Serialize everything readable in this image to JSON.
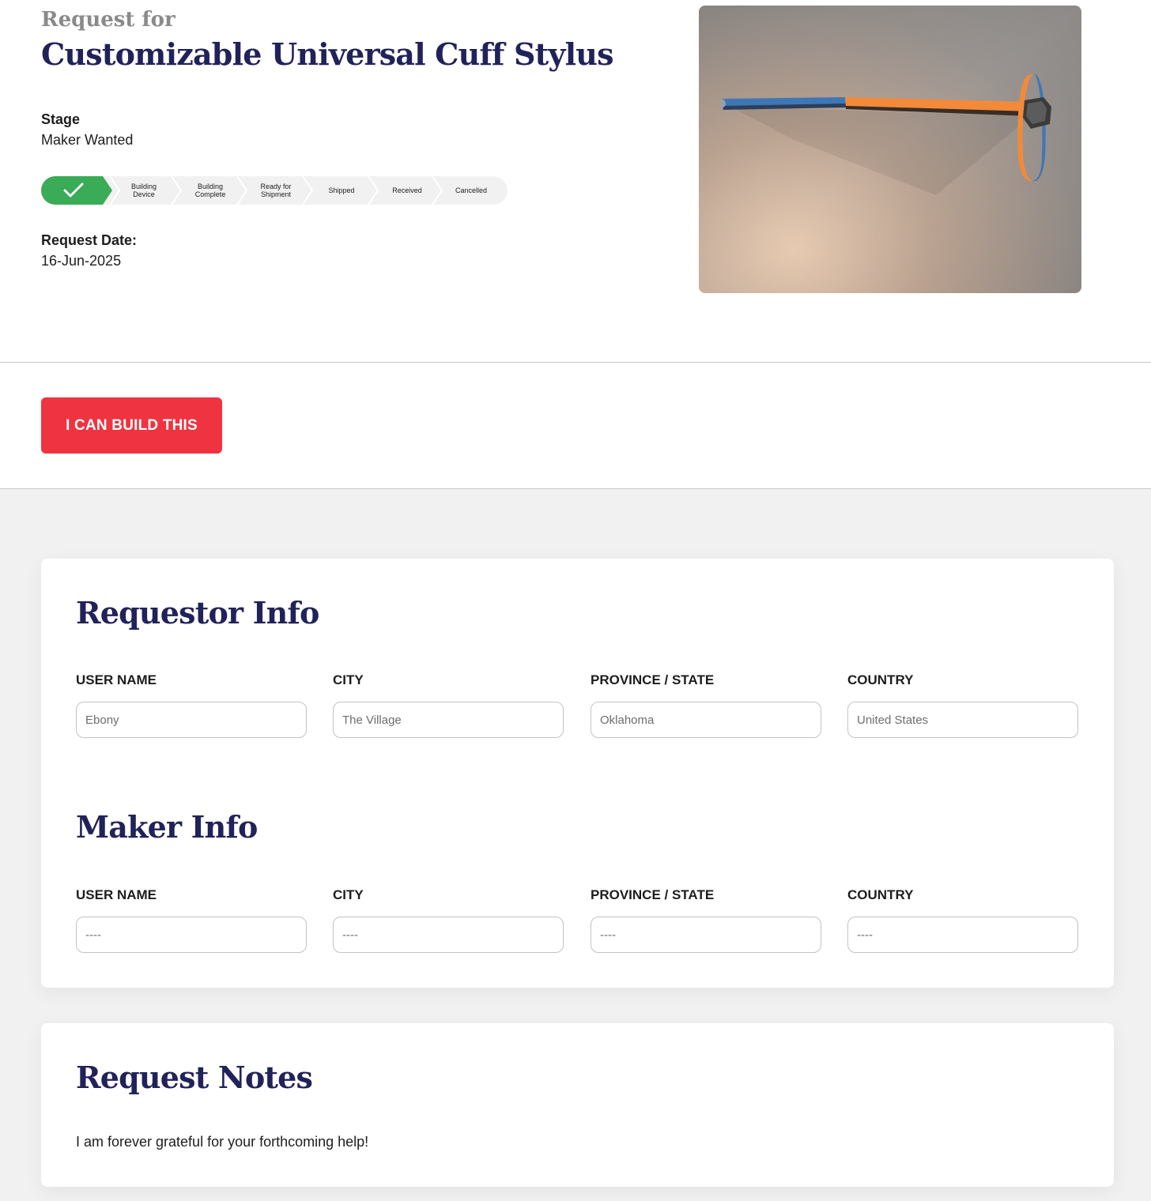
{
  "header": {
    "prefix": "Request for",
    "title": "Customizable Universal Cuff Stylus"
  },
  "stage": {
    "label": "Stage",
    "value": "Maker Wanted"
  },
  "progress": {
    "completed_icon": "check-icon",
    "steps": [
      "Building\nDevice",
      "Building\nComplete",
      "Ready for\nShipment",
      "Shipped",
      "Received",
      "Cancelled"
    ]
  },
  "request_date": {
    "label": "Request Date:",
    "value": "16-Jun-2025"
  },
  "action": {
    "build_label": "I CAN BUILD THIS"
  },
  "requestor_info": {
    "title": "Requestor Info",
    "fields": [
      {
        "label": "USER NAME",
        "value": "Ebony"
      },
      {
        "label": "CITY",
        "value": "The Village"
      },
      {
        "label": "PROVINCE / STATE",
        "value": "Oklahoma"
      },
      {
        "label": "COUNTRY",
        "value": "United States"
      }
    ]
  },
  "maker_info": {
    "title": "Maker Info",
    "fields": [
      {
        "label": "USER NAME",
        "value": "----"
      },
      {
        "label": "CITY",
        "value": "----"
      },
      {
        "label": "PROVINCE / STATE",
        "value": "----"
      },
      {
        "label": "COUNTRY",
        "value": "----"
      }
    ]
  },
  "request_notes": {
    "title": "Request Notes",
    "text": "I am forever grateful for your forthcoming help!"
  },
  "colors": {
    "title_navy": "#22225a",
    "button_red": "#ef3340",
    "stage_green": "#3aab57",
    "page_gray": "#f1f1f1"
  }
}
